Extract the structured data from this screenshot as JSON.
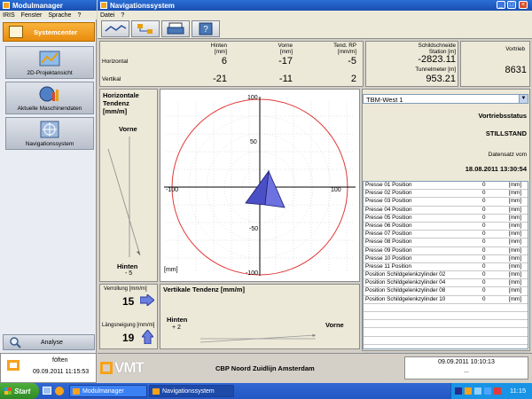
{
  "left_window": {
    "title": "Modulmanager",
    "menu": [
      "IRIS",
      "Fenster",
      "Sprache",
      "?"
    ],
    "system_button": "Systemcenter",
    "nav_items": [
      {
        "label": "2D-Projektansicht",
        "icon": "map-icon"
      },
      {
        "label": "Aktuelle Maschinendaten",
        "icon": "globe-chart-icon"
      },
      {
        "label": "Navigationssystem",
        "icon": "target-icon"
      }
    ],
    "analysis_button": "Analyse",
    "user": "föften",
    "timestamp": "09.09.2011 11:15:53"
  },
  "right_window": {
    "title": "Navigationssystem",
    "menu": [
      "Datei",
      "?"
    ],
    "toolbar": [
      "chart-icon",
      "flow-icon",
      "printer-icon",
      "help-icon"
    ],
    "header": {
      "col_hinten": "Hinten\n[mm]",
      "col_vorne": "Vorne\n[mm]",
      "col_tend": "Tend. RP\n[mm/m]",
      "row_horizontal": "Horizontal",
      "row_vertikal": "Vertikal",
      "h_hinten": "6",
      "h_vorne": "-17",
      "h_tend": "-5",
      "v_hinten": "-21",
      "v_vorne": "-11",
      "v_tend": "2",
      "station_label": "Schildschneide\nStation [m]",
      "station_value": "-2823.11",
      "tunnel_label": "Tunnelmeter [m]",
      "tunnel_value": "953.21",
      "vortrieb_label": "Vortrieb",
      "vortrieb_value": "8631"
    },
    "horizontal_tendency": {
      "title": "Horizontale\nTendenz\n[mm/m]",
      "vorne": "Vorne",
      "hinten": "Hinten",
      "hinten_value": "- 5"
    },
    "target_chart": {
      "ticks": {
        "top": "100",
        "mid_y": "50",
        "neg_y": "-50",
        "bottom": "-100",
        "left": "-100",
        "right": "100"
      },
      "unit": "[mm]"
    },
    "verrollung_label": "Verrollung [mm/m]",
    "verrollung_value": "15",
    "laengsneigung_label": "Längsneigung [mm/m]",
    "laengsneigung_value": "19",
    "vertical_tendency": {
      "title": "Vertikale Tendenz [mm/m]",
      "hinten": "Hinten",
      "hinten_value": "+ 2",
      "vorne": "Vorne"
    },
    "machine_select": "TBM-West 1",
    "status_label": "Vortriebsstatus",
    "status_value": "STILLSTAND",
    "datensatz_label": "Datensatz vom",
    "datensatz_value": "18.08.2011 13:30:54",
    "list": [
      {
        "name": "Presse 01 Position",
        "value": "0",
        "unit": "[mm]"
      },
      {
        "name": "Presse 02 Position",
        "value": "0",
        "unit": "[mm]"
      },
      {
        "name": "Presse 03 Position",
        "value": "0",
        "unit": "[mm]"
      },
      {
        "name": "Presse 04 Position",
        "value": "0",
        "unit": "[mm]"
      },
      {
        "name": "Presse 05 Position",
        "value": "0",
        "unit": "[mm]"
      },
      {
        "name": "Presse 06 Position",
        "value": "0",
        "unit": "[mm]"
      },
      {
        "name": "Presse 07 Position",
        "value": "0",
        "unit": "[mm]"
      },
      {
        "name": "Presse 08 Position",
        "value": "0",
        "unit": "[mm]"
      },
      {
        "name": "Presse 09 Position",
        "value": "0",
        "unit": "[mm]"
      },
      {
        "name": "Presse 10 Position",
        "value": "0",
        "unit": "[mm]"
      },
      {
        "name": "Presse 11 Position",
        "value": "0",
        "unit": "[mm]"
      },
      {
        "name": "Position Schildgelenkzylinder 02",
        "value": "0",
        "unit": "[mm]"
      },
      {
        "name": "Position Schildgelenkzylinder 04",
        "value": "0",
        "unit": "[mm]"
      },
      {
        "name": "Position Schildgelenkzylinder 08",
        "value": "0",
        "unit": "[mm]"
      },
      {
        "name": "Position Schildgelenkzylinder 10",
        "value": "0",
        "unit": "[mm]"
      }
    ],
    "footer": {
      "logo": "VMT",
      "project": "CBP Noord Zuidlijn Amsterdam",
      "date": "09.09.2011 10:10:13",
      "dots": "..."
    }
  },
  "taskbar": {
    "start": "Start",
    "tasks": [
      "Modulmanager",
      "Navigationssystem"
    ],
    "time": "11:15"
  }
}
